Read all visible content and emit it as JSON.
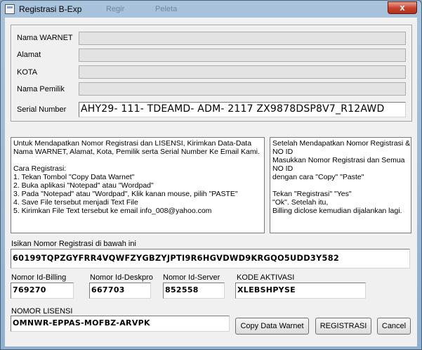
{
  "window": {
    "title": "Registrasi B-Exp",
    "ghost_menu": [
      "Regir",
      "Peleta"
    ],
    "close_label": "x"
  },
  "form": {
    "nama_warnet": {
      "label": "Nama WARNET",
      "value": ""
    },
    "alamat": {
      "label": "Alamat",
      "value": ""
    },
    "kota": {
      "label": "KOTA",
      "value": ""
    },
    "nama_pemilik": {
      "label": "Nama Pemilik",
      "value": ""
    },
    "serial": {
      "label": "Serial Number",
      "value": "AHY29- 111- TDEAMD- ADM- 2117 ZX9878DSP8V7_R12AWD"
    }
  },
  "info_left": "Untuk Mendapatkan Nomor Registrasi dan LISENSI, Kirimkan Data-Data\nNama WARNET, Alamat, Kota, Pemilik serta Serial Number Ke Email Kami.\n\nCara Registrasi:\n1. Tekan Tombol \"Copy Data Warnet\"\n2. Buka aplikasi \"Notepad\" atau \"Wordpad\"\n3. Pada \"Notepad\" atau \"Wordpad\", Klik kanan mouse, pilih \"PASTE\"\n4. Save File tersebut menjadi Text File\n5. Kirimkan File Text tersebut ke email info_008@yahoo.com",
  "info_right": "Setelah Mendapatkan Nomor Registrasi &\nNO ID\nMasukkan Nomor Registrasi dan Semua\nNO ID\ndengan cara \"Copy\" \"Paste\"\n\nTekan \"Registrasi\" \"Yes\"\n\"Ok\". Setelah itu,\nBilling diclose kemudian dijalankan lagi.",
  "registration": {
    "label": "Isikan Nomor Registrasi di bawah ini",
    "value": "60199TQPZGYFRR4VQWFZYGBZYJPTI9R6HGVDWD9KRGQO5UDD3Y582"
  },
  "ids": {
    "billing": {
      "label": "Nomor Id-Billing",
      "value": "769270"
    },
    "deskpro": {
      "label": "Nomor Id-Deskpro",
      "value": "667703"
    },
    "server": {
      "label": "Nomor Id-Server",
      "value": "852558"
    },
    "kode": {
      "label": "KODE AKTIVASI",
      "value": "XLEBSHPYSE"
    }
  },
  "license": {
    "label": "NOMOR LISENSI",
    "value": "OMNWR-EPPAS-MOFBZ-ARVPK"
  },
  "buttons": {
    "copy": "Copy Data Warnet",
    "registrasi": "REGISTRASI",
    "cancel": "Cancel"
  }
}
